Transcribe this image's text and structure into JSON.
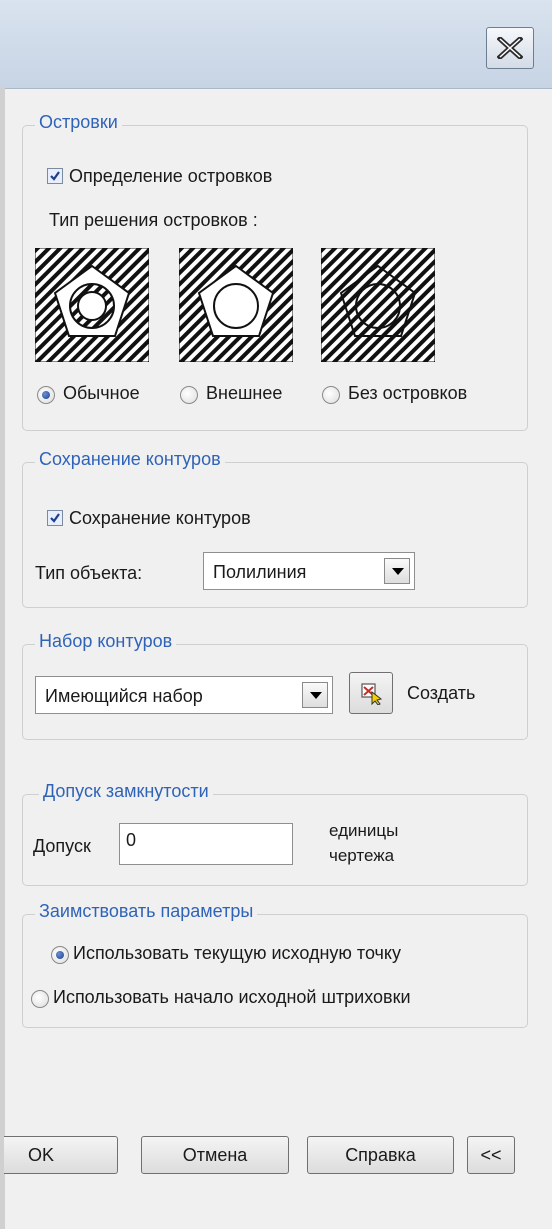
{
  "dialog": {
    "close_icon": "close-x-icon"
  },
  "islands": {
    "legend": "Островки",
    "detection_label": "Определение островков",
    "detection_checked": true,
    "style_label": "Тип решения островков :",
    "styles": [
      {
        "label": "Обычное",
        "selected": true,
        "icon": "island-normal-icon"
      },
      {
        "label": "Внешнее",
        "selected": false,
        "icon": "island-outer-icon"
      },
      {
        "label": "Без островков",
        "selected": false,
        "icon": "island-ignore-icon"
      }
    ]
  },
  "retain": {
    "legend": "Сохранение контуров",
    "checkbox_label": "Сохранение контуров",
    "checked": true,
    "object_type_label": "Тип объекта:",
    "object_type_value": "Полилиния"
  },
  "boundary_set": {
    "legend": "Набор контуров",
    "value": "Имеющийся набор",
    "new_label": "Создать",
    "new_icon": "select-objects-icon"
  },
  "gap": {
    "legend": "Допуск замкнутости",
    "label": "Допуск",
    "value": "0",
    "units_line1": "единицы",
    "units_line2": "чертежа"
  },
  "inherit": {
    "legend": "Заимствовать параметры",
    "options": [
      {
        "label": "Использовать текущую исходную точку",
        "selected": true
      },
      {
        "label": "Использовать начало исходной штриховки",
        "selected": false
      }
    ]
  },
  "footer": {
    "ok": "OK",
    "cancel": "Отмена",
    "help": "Справка",
    "collapse": "<<"
  },
  "colors": {
    "legend": "#2f63b8",
    "title_bar": "#d0dbe9"
  }
}
